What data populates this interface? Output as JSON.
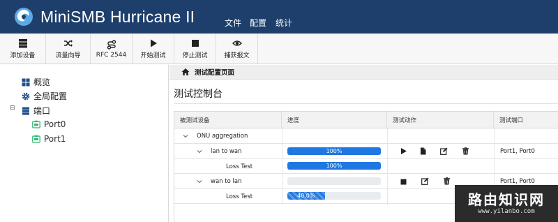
{
  "app": {
    "title": "MiniSMB Hurricane II",
    "menu": [
      "文件",
      "配置",
      "统计"
    ]
  },
  "toolbar": {
    "items": [
      {
        "label": "添加设备",
        "icon": "server-stack-icon"
      },
      {
        "label": "流量向导",
        "icon": "shuffle-icon"
      },
      {
        "label": "RFC 2544",
        "icon": "route-icon"
      },
      {
        "label": "开始测试",
        "icon": "play-icon"
      },
      {
        "label": "停止测试",
        "icon": "stop-icon"
      },
      {
        "label": "捕获报文",
        "icon": "eye-icon"
      }
    ]
  },
  "sidebar": {
    "items": [
      {
        "label": "概览",
        "icon": "grid-icon"
      },
      {
        "label": "全局配置",
        "icon": "gear-icon"
      },
      {
        "label": "端口",
        "icon": "server-icon"
      },
      {
        "label": "Port0",
        "icon": "port-icon"
      },
      {
        "label": "Port1",
        "icon": "port-icon"
      }
    ],
    "expand_glyph": "⊟"
  },
  "breadcrumb": {
    "label": "测试配置页面",
    "icon": "home-icon"
  },
  "page_title": "测试控制台",
  "table": {
    "headers": [
      "被测试设备",
      "进度",
      "测试动作",
      "测试端口"
    ],
    "group": {
      "label": "ONU aggregation"
    },
    "rows": [
      {
        "label": "lan to wan",
        "progress_pct": 100,
        "progress_label": "100%",
        "ports": "Port1, Port0",
        "actions": [
          "play-icon",
          "file-icon",
          "edit-icon",
          "trash-icon"
        ]
      },
      {
        "label": "Loss Test",
        "progress_pct": 100,
        "progress_label": "100%"
      },
      {
        "label": "wan to lan",
        "progress_pct": 0,
        "progress_label": "",
        "ports": "Port1, Port0",
        "actions": [
          "stop-icon",
          "edit-icon",
          "trash-icon"
        ]
      },
      {
        "label": "Loss Test",
        "progress_pct": 40,
        "progress_label": "40.0%"
      }
    ]
  },
  "watermark": {
    "title": "路由知识网",
    "url": "www.yilanbo.com"
  },
  "colors": {
    "header_bg": "#1e3f6b",
    "progress": "#1f78e1",
    "accent_green": "#2eb872"
  }
}
